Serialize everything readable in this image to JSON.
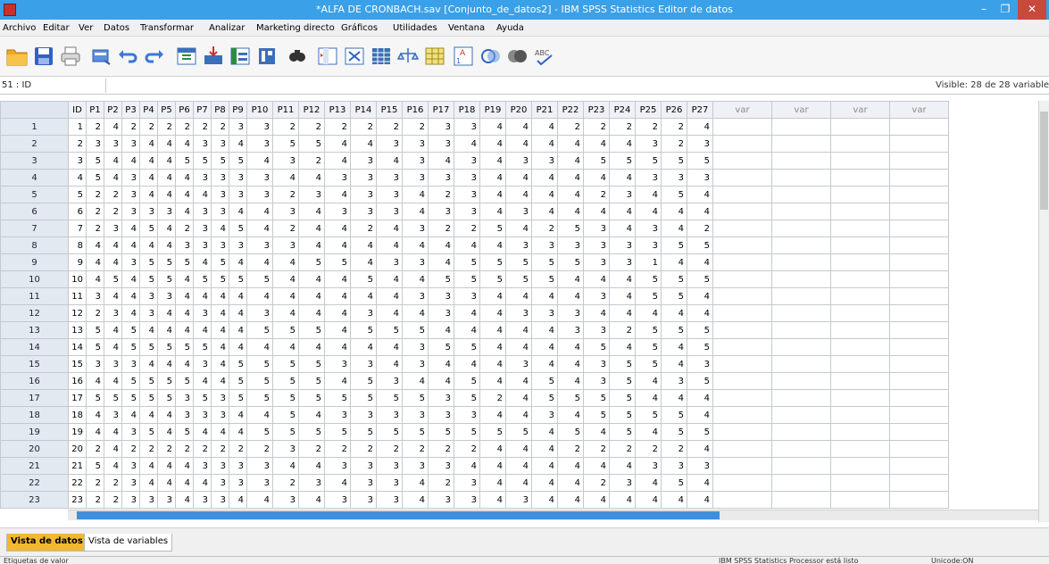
{
  "window": {
    "title": "*ALFA DE CRONBACH.sav [Conjunto_de_datos2] - IBM SPSS Statistics Editor de datos",
    "minimize": "–",
    "maximize": "❐",
    "close": "✕"
  },
  "menu": [
    "Archivo",
    "Editar",
    "Ver",
    "Datos",
    "Transformar",
    "Analizar",
    "Marketing directo",
    "Gráficos",
    "Utilidades",
    "Ventana",
    "Ayuda"
  ],
  "cellbar": {
    "ref": "51 : ID",
    "visible": "Visible: 28 de 28 variable"
  },
  "grid": {
    "columns": [
      "ID",
      "P1",
      "P2",
      "P3",
      "P4",
      "P5",
      "P6",
      "P7",
      "P8",
      "P9",
      "P10",
      "P11",
      "P12",
      "P13",
      "P14",
      "P15",
      "P16",
      "P17",
      "P18",
      "P19",
      "P20",
      "P21",
      "P22",
      "P23",
      "P24",
      "P25",
      "P26",
      "P27"
    ],
    "extra_columns": [
      "var",
      "var",
      "var",
      "var"
    ],
    "rows": [
      [
        "1",
        "1",
        "2",
        "4",
        "2",
        "2",
        "2",
        "2",
        "2",
        "2",
        "3",
        "3",
        "2",
        "2",
        "2",
        "2",
        "2",
        "2",
        "3",
        "3",
        "4",
        "4",
        "4",
        "2",
        "2",
        "2",
        "2",
        "2",
        "4"
      ],
      [
        "2",
        "2",
        "3",
        "3",
        "3",
        "4",
        "4",
        "4",
        "3",
        "3",
        "4",
        "3",
        "5",
        "5",
        "4",
        "4",
        "3",
        "3",
        "3",
        "4",
        "4",
        "4",
        "4",
        "4",
        "4",
        "4",
        "3",
        "2",
        "3"
      ],
      [
        "3",
        "3",
        "5",
        "4",
        "4",
        "4",
        "4",
        "5",
        "5",
        "5",
        "5",
        "4",
        "3",
        "2",
        "4",
        "3",
        "4",
        "3",
        "4",
        "3",
        "4",
        "3",
        "3",
        "4",
        "5",
        "5",
        "5",
        "5",
        "5"
      ],
      [
        "4",
        "4",
        "5",
        "4",
        "3",
        "4",
        "4",
        "4",
        "3",
        "3",
        "3",
        "3",
        "4",
        "4",
        "3",
        "3",
        "3",
        "3",
        "3",
        "3",
        "4",
        "4",
        "4",
        "4",
        "4",
        "4",
        "3",
        "3",
        "3"
      ],
      [
        "5",
        "5",
        "2",
        "2",
        "3",
        "4",
        "4",
        "4",
        "4",
        "3",
        "3",
        "3",
        "2",
        "3",
        "4",
        "3",
        "3",
        "4",
        "2",
        "3",
        "4",
        "4",
        "4",
        "4",
        "2",
        "3",
        "4",
        "5",
        "4"
      ],
      [
        "6",
        "6",
        "2",
        "2",
        "3",
        "3",
        "3",
        "4",
        "3",
        "3",
        "4",
        "4",
        "3",
        "4",
        "3",
        "3",
        "3",
        "4",
        "3",
        "3",
        "4",
        "3",
        "4",
        "4",
        "4",
        "4",
        "4",
        "4",
        "4"
      ],
      [
        "7",
        "7",
        "2",
        "3",
        "4",
        "5",
        "4",
        "2",
        "3",
        "4",
        "5",
        "4",
        "2",
        "4",
        "4",
        "2",
        "4",
        "3",
        "2",
        "2",
        "5",
        "4",
        "2",
        "5",
        "3",
        "4",
        "3",
        "4",
        "2"
      ],
      [
        "8",
        "8",
        "4",
        "4",
        "4",
        "4",
        "4",
        "3",
        "3",
        "3",
        "3",
        "3",
        "3",
        "4",
        "4",
        "4",
        "4",
        "4",
        "4",
        "4",
        "4",
        "3",
        "3",
        "3",
        "3",
        "3",
        "3",
        "5",
        "5"
      ],
      [
        "9",
        "9",
        "4",
        "4",
        "3",
        "5",
        "5",
        "5",
        "4",
        "5",
        "4",
        "4",
        "4",
        "5",
        "5",
        "4",
        "3",
        "3",
        "4",
        "5",
        "5",
        "5",
        "5",
        "5",
        "3",
        "3",
        "1",
        "4",
        "4"
      ],
      [
        "10",
        "10",
        "4",
        "5",
        "4",
        "5",
        "5",
        "4",
        "5",
        "5",
        "5",
        "5",
        "4",
        "4",
        "4",
        "5",
        "4",
        "4",
        "5",
        "5",
        "5",
        "5",
        "5",
        "4",
        "4",
        "4",
        "5",
        "5",
        "5"
      ],
      [
        "11",
        "11",
        "3",
        "4",
        "4",
        "3",
        "3",
        "4",
        "4",
        "4",
        "4",
        "4",
        "4",
        "4",
        "4",
        "4",
        "4",
        "3",
        "3",
        "3",
        "4",
        "4",
        "4",
        "4",
        "3",
        "4",
        "5",
        "5",
        "4"
      ],
      [
        "12",
        "12",
        "2",
        "3",
        "4",
        "3",
        "4",
        "4",
        "3",
        "4",
        "4",
        "3",
        "4",
        "4",
        "4",
        "3",
        "4",
        "4",
        "3",
        "4",
        "4",
        "3",
        "3",
        "3",
        "4",
        "4",
        "4",
        "4",
        "4"
      ],
      [
        "13",
        "13",
        "5",
        "4",
        "5",
        "4",
        "4",
        "4",
        "4",
        "4",
        "4",
        "5",
        "5",
        "5",
        "4",
        "5",
        "5",
        "5",
        "4",
        "4",
        "4",
        "4",
        "4",
        "3",
        "3",
        "2",
        "5",
        "5",
        "5"
      ],
      [
        "14",
        "14",
        "5",
        "4",
        "5",
        "5",
        "5",
        "5",
        "5",
        "4",
        "4",
        "4",
        "4",
        "4",
        "4",
        "4",
        "4",
        "3",
        "5",
        "5",
        "4",
        "4",
        "4",
        "4",
        "5",
        "4",
        "5",
        "4",
        "5"
      ],
      [
        "15",
        "15",
        "3",
        "3",
        "3",
        "4",
        "4",
        "4",
        "3",
        "4",
        "5",
        "5",
        "5",
        "5",
        "3",
        "3",
        "4",
        "3",
        "4",
        "4",
        "4",
        "3",
        "4",
        "4",
        "3",
        "5",
        "5",
        "4",
        "3"
      ],
      [
        "16",
        "16",
        "4",
        "4",
        "5",
        "5",
        "5",
        "5",
        "4",
        "4",
        "5",
        "5",
        "5",
        "5",
        "4",
        "5",
        "3",
        "4",
        "4",
        "5",
        "4",
        "4",
        "5",
        "4",
        "3",
        "5",
        "4",
        "3",
        "5"
      ],
      [
        "17",
        "17",
        "5",
        "5",
        "5",
        "5",
        "5",
        "3",
        "5",
        "3",
        "5",
        "5",
        "5",
        "5",
        "5",
        "5",
        "5",
        "5",
        "3",
        "5",
        "2",
        "4",
        "5",
        "5",
        "5",
        "5",
        "4",
        "4",
        "4"
      ],
      [
        "18",
        "18",
        "4",
        "3",
        "4",
        "4",
        "4",
        "3",
        "3",
        "3",
        "4",
        "4",
        "5",
        "4",
        "3",
        "3",
        "3",
        "3",
        "3",
        "3",
        "4",
        "4",
        "3",
        "4",
        "5",
        "5",
        "5",
        "5",
        "4"
      ],
      [
        "19",
        "19",
        "4",
        "4",
        "3",
        "5",
        "4",
        "5",
        "4",
        "4",
        "4",
        "5",
        "5",
        "5",
        "5",
        "5",
        "5",
        "5",
        "5",
        "5",
        "5",
        "5",
        "4",
        "5",
        "4",
        "5",
        "4",
        "5",
        "5"
      ],
      [
        "20",
        "20",
        "2",
        "4",
        "2",
        "2",
        "2",
        "2",
        "2",
        "2",
        "2",
        "2",
        "3",
        "2",
        "2",
        "2",
        "2",
        "2",
        "2",
        "2",
        "4",
        "4",
        "4",
        "2",
        "2",
        "2",
        "2",
        "2",
        "4"
      ],
      [
        "21",
        "21",
        "5",
        "4",
        "3",
        "4",
        "4",
        "4",
        "3",
        "3",
        "3",
        "3",
        "4",
        "4",
        "3",
        "3",
        "3",
        "3",
        "3",
        "4",
        "4",
        "4",
        "4",
        "4",
        "4",
        "4",
        "3",
        "3",
        "3"
      ],
      [
        "22",
        "22",
        "2",
        "2",
        "3",
        "4",
        "4",
        "4",
        "4",
        "3",
        "3",
        "3",
        "2",
        "3",
        "4",
        "3",
        "3",
        "4",
        "2",
        "3",
        "4",
        "4",
        "4",
        "4",
        "2",
        "3",
        "4",
        "5",
        "4"
      ],
      [
        "23",
        "23",
        "2",
        "2",
        "3",
        "3",
        "3",
        "4",
        "3",
        "3",
        "4",
        "4",
        "3",
        "4",
        "3",
        "3",
        "3",
        "4",
        "3",
        "3",
        "4",
        "3",
        "4",
        "4",
        "4",
        "4",
        "4",
        "4",
        "4"
      ]
    ]
  },
  "tabs": {
    "data_view": "Vista de datos",
    "variable_view": "Vista de variables"
  },
  "status": {
    "left": "Etiquetas de valor",
    "processor": "IBM SPSS Statistics Processor está listo",
    "unicode": "Unicode:ON"
  },
  "colors": {
    "titlebar": "#3aa0e8",
    "active_tab": "#f4b731",
    "scroll_thumb": "#3e8fe0"
  }
}
